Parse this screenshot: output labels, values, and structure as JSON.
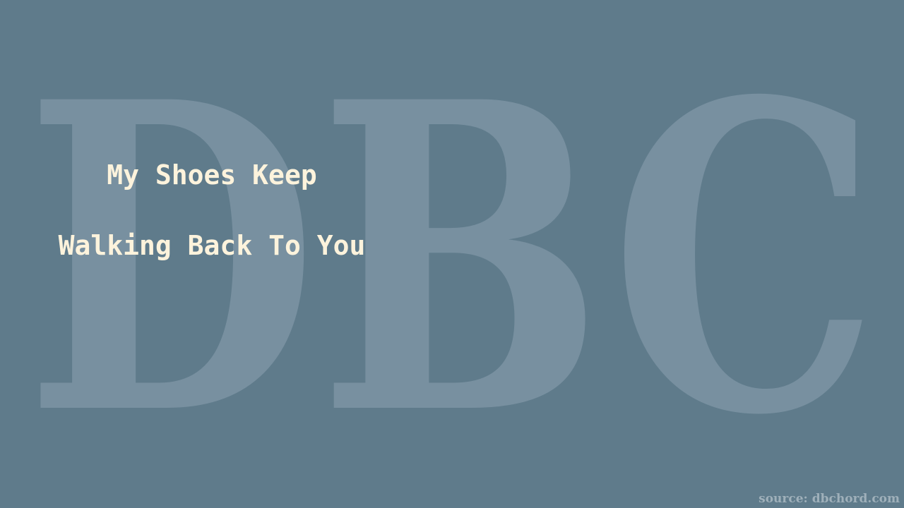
{
  "watermark": {
    "letters": "DBC",
    "color": "#7890a0"
  },
  "song": {
    "title_line_1": "My Shoes Keep",
    "title_line_2": "Walking Back To You",
    "color": "#fdf3dc"
  },
  "footer": {
    "source_text": "source: dbchord.com",
    "color": "#9fb0ba"
  },
  "background_color": "#5f7b8b"
}
